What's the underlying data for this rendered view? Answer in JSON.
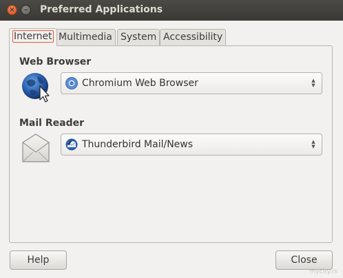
{
  "window": {
    "title": "Preferred Applications",
    "close_glyph": "×",
    "minimize_glyph": "–"
  },
  "tabs": [
    {
      "label": "Internet",
      "active": true
    },
    {
      "label": "Multimedia",
      "active": false
    },
    {
      "label": "System",
      "active": false
    },
    {
      "label": "Accessibility",
      "active": false
    }
  ],
  "sections": {
    "web_browser": {
      "heading": "Web Browser",
      "icon": "globe-cursor-icon",
      "selected": "Chromium Web Browser",
      "selected_icon": "chromium-icon"
    },
    "mail_reader": {
      "heading": "Mail Reader",
      "icon": "envelope-icon",
      "selected": "Thunderbird Mail/News",
      "selected_icon": "thunderbird-icon"
    }
  },
  "buttons": {
    "help": "Help",
    "close": "Close"
  },
  "watermark": "mycity.rs",
  "colors": {
    "titlebar": "#3c3b37",
    "window_bg": "#f2f1f0",
    "active_tab_outline": "#e05a3a",
    "close_button": "#e0591f"
  }
}
